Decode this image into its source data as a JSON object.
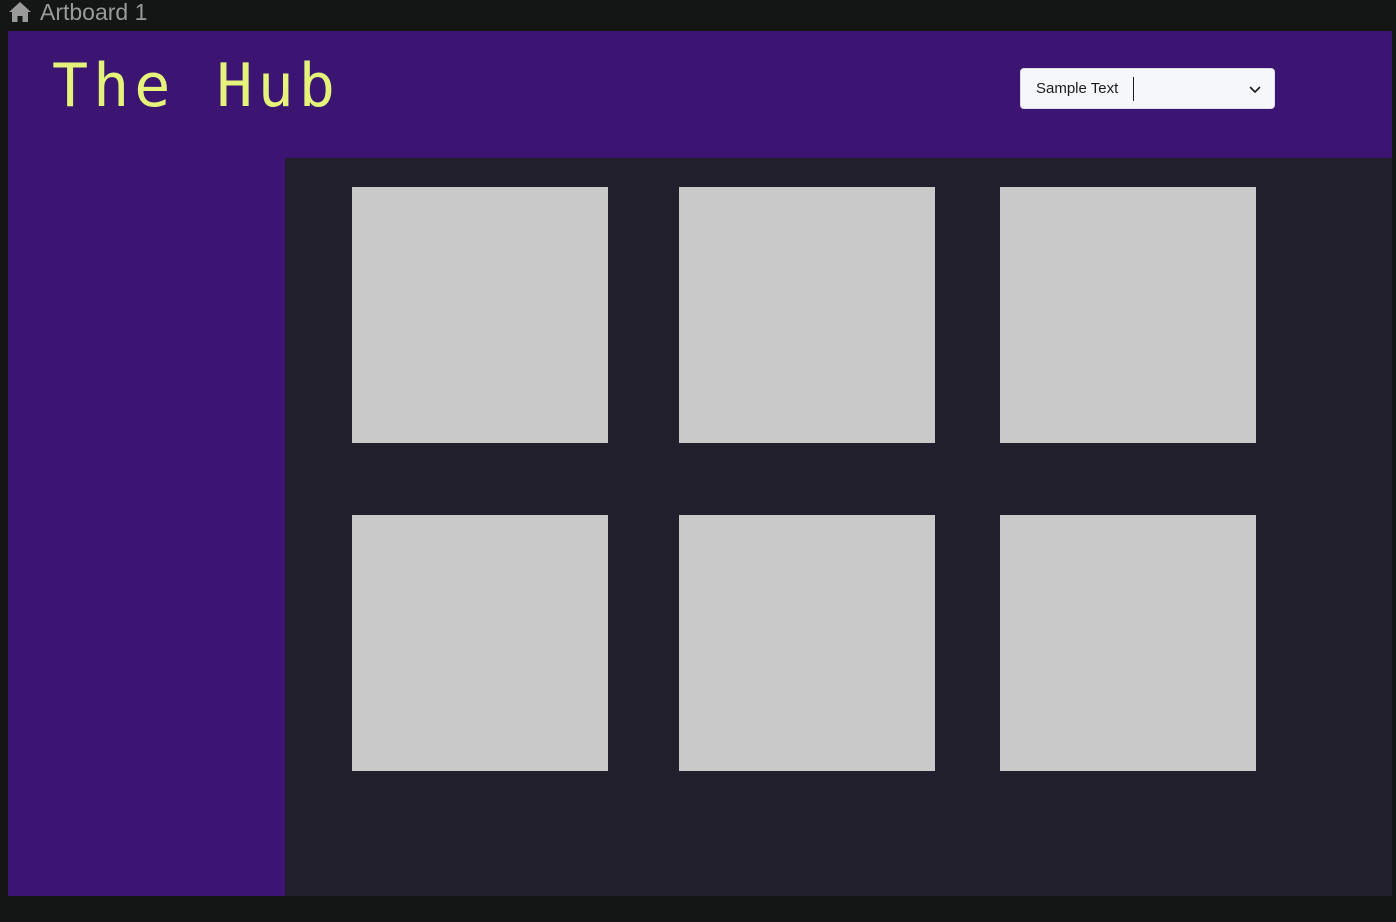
{
  "artboard": {
    "title": "Artboard 1",
    "icon": "home-icon"
  },
  "header": {
    "brand": "The Hub",
    "brand_color": "#e6f37a",
    "background": "#3b1571"
  },
  "dropdown": {
    "selected_label": "Sample Text",
    "icon": "chevron-down-icon"
  },
  "grid": {
    "background": "#221f2c",
    "tile_color": "#c9c9c9",
    "tile_count": 6
  }
}
